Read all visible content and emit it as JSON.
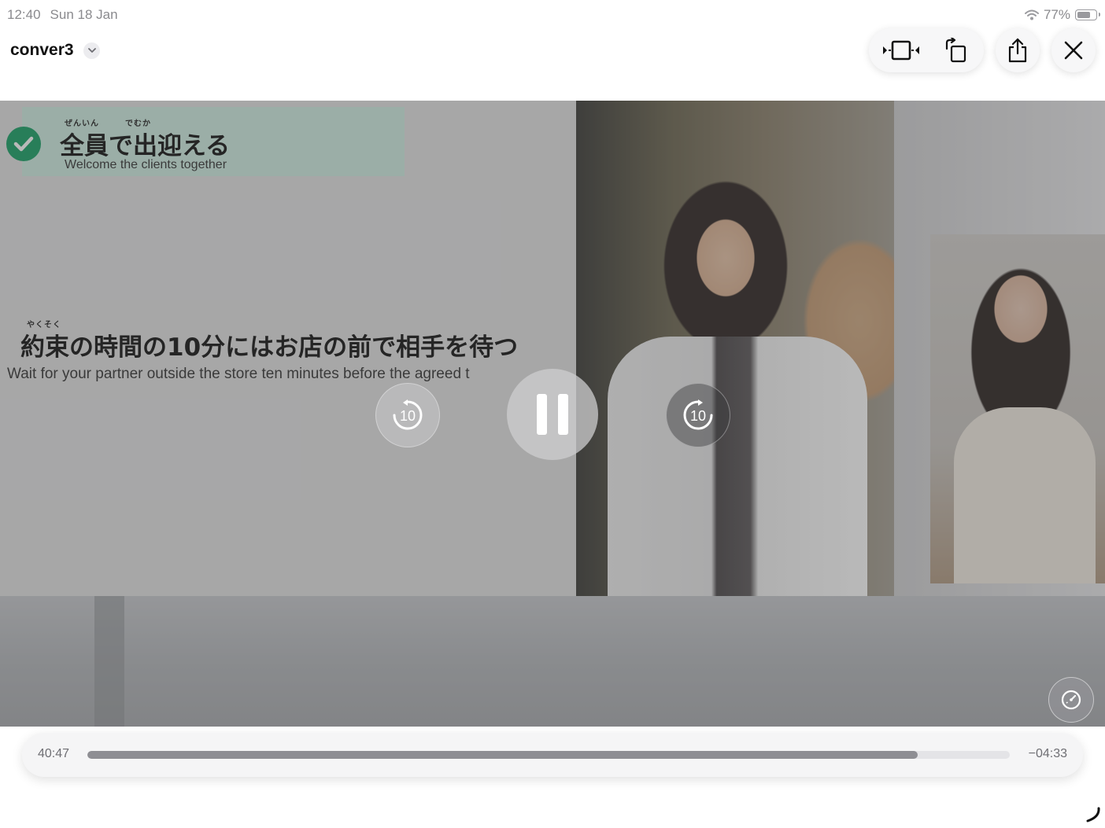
{
  "status_bar": {
    "time": "12:40",
    "date": "Sun 18 Jan",
    "battery": "77%",
    "battery_level": 0.77,
    "wifi_icon": "wifi-icon"
  },
  "header": {
    "title": "conver3",
    "chevron_icon": "chevron-down-icon",
    "buttons": {
      "fit_icon": "aspect-fit-icon",
      "rotate_icon": "rotate-icon",
      "share_icon": "share-icon",
      "close_icon": "close-icon"
    }
  },
  "video": {
    "slide": {
      "heading_ruby": "ぜんいん　　　でむか",
      "heading_jp": "全員で出迎える",
      "heading_en": "Welcome the clients together",
      "body_ruby": "やくそく",
      "body_jp": "約束の時間の10分にはお店の前で相手を待つ",
      "body_en": "Wait for your partner outside the store ten minutes before the agreed t"
    },
    "controls": {
      "skip_back_label": "10",
      "skip_forward_label": "10",
      "pause_icon": "pause-icon",
      "speed_icon": "speed-icon"
    }
  },
  "player": {
    "elapsed": "40:47",
    "remaining": "−04:33",
    "progress": 0.9
  },
  "colors": {
    "accent_green": "#16a064",
    "banner_mint": "#cfeee3"
  }
}
